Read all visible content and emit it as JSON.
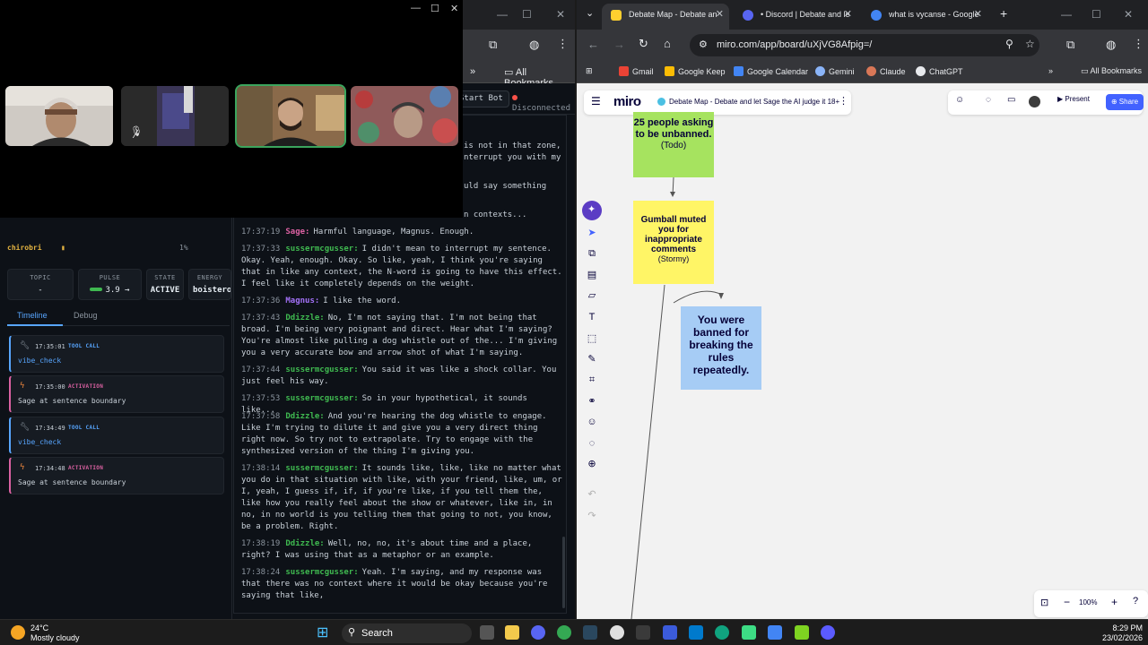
{
  "left_browser": {
    "bookmarks_label": "All Bookmarks"
  },
  "dashboard": {
    "start_bot_label": "Start Bot",
    "connection_status": "Disconnected",
    "user_strip": {
      "name": "chirobri",
      "pct": "1%"
    },
    "stats": [
      {
        "label": "TOPIC",
        "value": "-"
      },
      {
        "label": "PULSE",
        "value": "3.9 →"
      },
      {
        "label": "STATE",
        "value": "ACTIVE"
      },
      {
        "label": "ENERGY",
        "value": "boisterous"
      }
    ],
    "tabs": [
      {
        "label": "Timeline"
      },
      {
        "label": "Debug"
      }
    ],
    "timeline": [
      {
        "time": "17:35:01",
        "kind": "TOOL CALL",
        "body": "vibe_check",
        "icon": "wrench-icon"
      },
      {
        "time": "17:35:00",
        "kind": "ACTIVATION",
        "body": "Sage at sentence boundary",
        "icon": "lightning-icon"
      },
      {
        "time": "17:34:49",
        "kind": "TOOL CALL",
        "body": "vibe_check",
        "icon": "wrench-icon"
      },
      {
        "time": "17:34:48",
        "kind": "ACTIVATION",
        "body": "Sage at sentence boundary",
        "icon": "lightning-icon"
      }
    ],
    "transcript_partial": [
      "is not in that zone,",
      "nterrupt you with my",
      "uld say something",
      "n contexts..."
    ],
    "transcript": [
      {
        "time": "17:37:19",
        "speaker": "Sage:",
        "kind": "sage",
        "text": "Harmful language, Magnus. Enough."
      },
      {
        "time": "17:37:33",
        "speaker": "sussermcgusser:",
        "kind": "user",
        "text": "I didn't mean to interrupt my sentence. Okay. Yeah, enough. Okay. So like, yeah, I think you're saying that in like any context, the N-word is going to have this effect. I feel like it completely depends on the weight."
      },
      {
        "time": "17:37:36",
        "speaker": "Magnus:",
        "kind": "magnus",
        "text": "I like the word."
      },
      {
        "time": "17:37:43",
        "speaker": "Ddizzle:",
        "kind": "user",
        "text": "No, I'm not saying that. I'm not being that broad. I'm being very poignant and direct. Hear what I'm saying? You're almost like pulling a dog whistle out of the... I'm giving you a very accurate bow and arrow shot of what I'm saying."
      },
      {
        "time": "17:37:44",
        "speaker": "sussermcgusser:",
        "kind": "user",
        "text": "You said it was like a shock collar. You just feel his way."
      },
      {
        "time": "17:37:53",
        "speaker": "sussermcgusser:",
        "kind": "user",
        "text": "So in your hypothetical, it sounds like..."
      },
      {
        "time": "17:37:58",
        "speaker": "Ddizzle:",
        "kind": "user",
        "text": "And you're hearing the dog whistle to engage. Like I'm trying to dilute it and give you a very direct thing right now. So try not to extrapolate. Try to engage with the synthesized version of the thing I'm giving you."
      },
      {
        "time": "17:38:14",
        "speaker": "sussermcgusser:",
        "kind": "user",
        "text": "It sounds like, like, like no matter what you do in that situation with like, with your friend, like, um, or I, yeah, I guess if, if, if you're like, if you tell them the, like how you really feel about the show or whatever, like in, in no, in no world is you telling them that going to not, you know, be a problem. Right."
      },
      {
        "time": "17:38:19",
        "speaker": "Ddizzle:",
        "kind": "user",
        "text": "Well, no, no, it's about time and a place, right? I was using that as a metaphor or an example."
      },
      {
        "time": "17:38:24",
        "speaker": "sussermcgusser:",
        "kind": "user",
        "text": "Yeah. I'm saying, and my response was that there was no context where it would be okay because you're saying that like,"
      }
    ]
  },
  "right_browser": {
    "tabs": [
      {
        "title": "Debate Map - Debate an",
        "color": "#ffd02f",
        "active": true
      },
      {
        "title": "• Discord | Debate and le",
        "color": "#5865f2",
        "active": false
      },
      {
        "title": "what is vycanse - Google",
        "color": "#4285f4",
        "active": false
      }
    ],
    "url": "miro.com/app/board/uXjVG8Afpig=/",
    "bookmarks": [
      {
        "label": "Gmail",
        "color": "#ea4335"
      },
      {
        "label": "Google Keep",
        "color": "#fbbc04"
      },
      {
        "label": "Google Calendar",
        "color": "#4285f4"
      },
      {
        "label": "Gemini",
        "color": "#8ab4f8"
      },
      {
        "label": "Claude",
        "color": "#d97757"
      },
      {
        "label": "ChatGPT",
        "color": "#e8eaed"
      }
    ],
    "bookmarks_all": "All Bookmarks"
  },
  "miro": {
    "logo": "miro",
    "board_name": "Debate Map - Debate and let Sage the AI judge it 18+",
    "present_label": "Present",
    "share_label": "Share",
    "zoom": "100%",
    "stickies": [
      {
        "main": "25 people asking to be unbanned.",
        "sub": "(Todo)",
        "color": "#a6e35f"
      },
      {
        "main": "Gumball muted you for inappropriate comments",
        "sub": "(Stormy)",
        "color": "#fff566"
      },
      {
        "main": "You were banned for breaking the rules repeatedly.",
        "sub": "",
        "color": "#a6ccf5"
      }
    ]
  },
  "taskbar": {
    "temp": "24°C",
    "condition": "Mostly cloudy",
    "search_label": "Search",
    "time": "8:29 PM",
    "date": "23/02/2026"
  }
}
